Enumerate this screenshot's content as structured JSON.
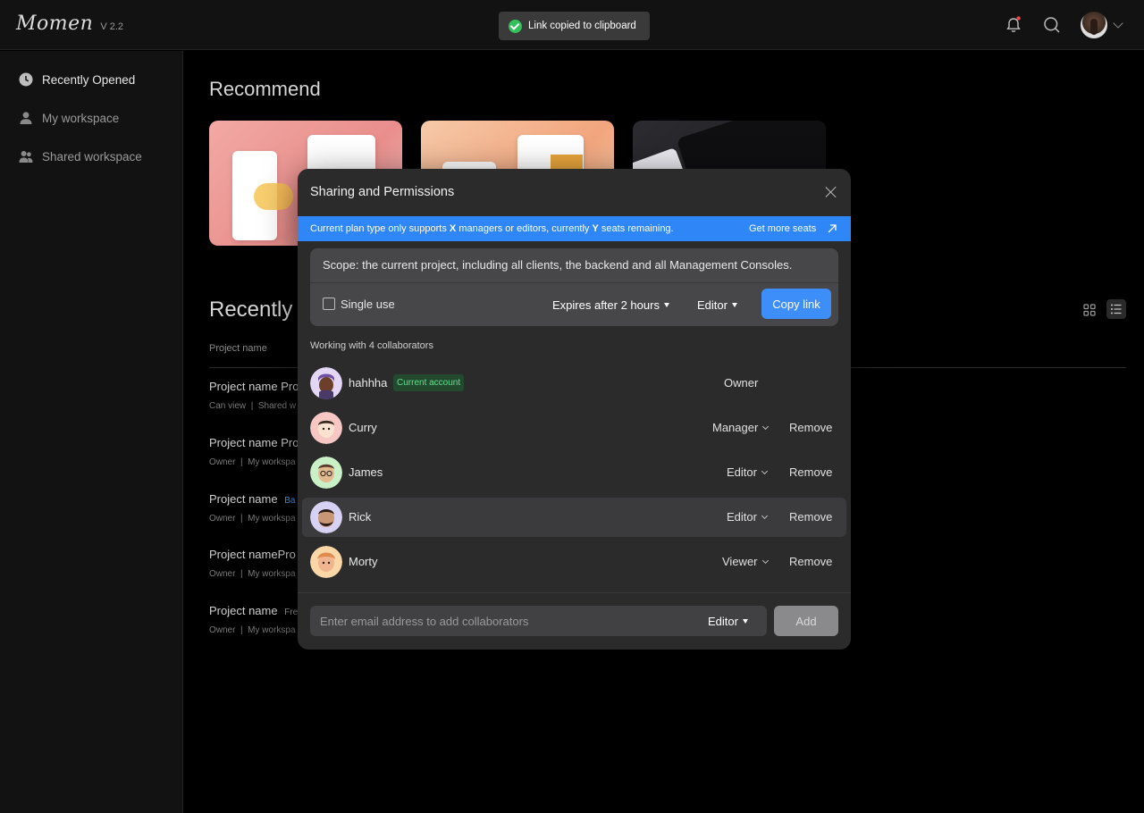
{
  "app": {
    "logo": "Momen",
    "version": "V 2.2"
  },
  "toast": {
    "text": "Link copied to clipboard"
  },
  "sidebar": {
    "items": [
      {
        "label": "Recently Opened",
        "icon": "clock-icon"
      },
      {
        "label": "My workspace",
        "icon": "person-icon"
      },
      {
        "label": "Shared workspace",
        "icon": "people-icon"
      }
    ]
  },
  "main": {
    "recommend_title": "Recommend",
    "recent_title": "Recently O",
    "column_header": "Project name",
    "rows": [
      {
        "title": "Project name Pro",
        "sub1": "Can view",
        "sub2": "Shared w"
      },
      {
        "title": "Project name Pro",
        "sub1": "Owner",
        "sub2": "My workspa"
      },
      {
        "title": "Project name",
        "tag": "Ba",
        "sub1": "Owner",
        "sub2": "My workspa"
      },
      {
        "title": "Project namePro",
        "sub1": "Owner",
        "sub2": "My workspa"
      },
      {
        "title": "Project name",
        "tag": "Fre",
        "sub1": "Owner",
        "sub2": "My workspa"
      }
    ]
  },
  "modal": {
    "title": "Sharing and Permissions",
    "banner": {
      "text_1": "Current plan type only supports ",
      "x": "X",
      "text_2": " managers or editors, currently ",
      "y": "Y",
      "text_3": " seats remaining.",
      "link": "Get more seats"
    },
    "scope": "Scope: the current project, including all clients, the backend and all Management Consoles.",
    "single_use": "Single use",
    "expires": "Expires after 2 hours",
    "link_role": "Editor",
    "copy_link": "Copy link",
    "working_with": "Working with 4 collaborators",
    "members": [
      {
        "name": "hahhha",
        "badge": "Current account",
        "role": "Owner"
      },
      {
        "name": "Curry",
        "role": "Manager",
        "remove": "Remove"
      },
      {
        "name": "James",
        "role": "Editor",
        "remove": "Remove"
      },
      {
        "name": "Rick",
        "role": "Editor",
        "remove": "Remove"
      },
      {
        "name": "Morty",
        "role": "Viewer",
        "remove": "Remove"
      }
    ],
    "email_placeholder": "Enter email address to add collaborators",
    "email_role": "Editor",
    "add": "Add"
  },
  "colors": {
    "accent": "#3d8ef8",
    "banner": "#2f86f6",
    "success": "#32c15a"
  }
}
